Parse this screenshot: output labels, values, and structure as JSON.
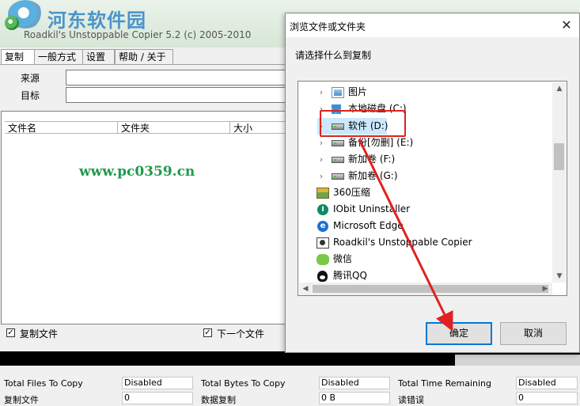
{
  "watermark": {
    "site": "河东软件园",
    "url": "www.pc0359.cn"
  },
  "main_window": {
    "title": "Roadkil's Unstoppable Copier 5.2 (c) 2005-2010",
    "tabs": [
      "复制",
      "一般方式",
      "设置",
      "帮助 / 关于"
    ],
    "source_label": "来源",
    "target_label": "目标",
    "source_value": "",
    "target_value": "",
    "columns": [
      "文件名",
      "文件夹",
      "大小"
    ],
    "copy_files_label": "复制文件",
    "next_file_label": "下一个文件",
    "copy_files_checked": true,
    "next_file_checked": true,
    "stats": [
      {
        "label": "Total Files To Copy",
        "value": "Disabled"
      },
      {
        "label": "Total Bytes To Copy",
        "value": "Disabled"
      },
      {
        "label": "Total Time Remaining",
        "value": "Disabled"
      },
      {
        "label": "复制文件",
        "value": "0"
      },
      {
        "label": "数据复制",
        "value": "0 B"
      },
      {
        "label": "读错误",
        "value": "0"
      }
    ]
  },
  "dialog": {
    "title": "浏览文件或文件夹",
    "close_glyph": "✕",
    "prompt": "请选择什么到复制",
    "tree_items": [
      {
        "label": "图片",
        "icon": "pictures-icon",
        "expandable": true
      },
      {
        "label": "本地磁盘 (C:)",
        "icon": "windows-drive-icon",
        "expandable": true
      },
      {
        "label": "软件 (D:)",
        "icon": "drive-icon",
        "expandable": true,
        "selected": true
      },
      {
        "label": "备份[勿删] (E:)",
        "icon": "drive-icon",
        "expandable": true
      },
      {
        "label": "新加卷 (F:)",
        "icon": "drive-icon",
        "expandable": true
      },
      {
        "label": "新加卷 (G:)",
        "icon": "drive-icon",
        "expandable": true
      },
      {
        "label": "360压缩",
        "icon": "360zip-icon",
        "expandable": false
      },
      {
        "label": "IObit Uninstaller",
        "icon": "iobit-icon",
        "expandable": false
      },
      {
        "label": "Microsoft Edge",
        "icon": "edge-icon",
        "expandable": false
      },
      {
        "label": "Roadkil's Unstoppable Copier",
        "icon": "copier-icon",
        "expandable": false
      },
      {
        "label": "微信",
        "icon": "wechat-icon",
        "expandable": false
      },
      {
        "label": "腾讯QQ",
        "icon": "qq-icon",
        "expandable": false
      }
    ],
    "ok_label": "确定",
    "cancel_label": "取消"
  },
  "colors": {
    "highlight": "#e0211e",
    "selection": "#cce8ff",
    "primary_border": "#0078d7"
  }
}
